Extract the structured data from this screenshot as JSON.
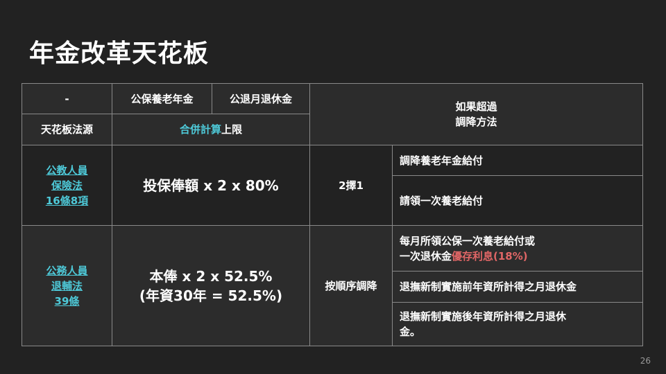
{
  "title": "年金改革天花板",
  "header": {
    "dash": "-",
    "col_insurance": "公保養老年金",
    "col_pension": "公退月退休金",
    "over_line1": "如果超過",
    "over_line2": "調降方法",
    "source_label": "天花板法源",
    "merge_teal": "合併計算",
    "merge_rest": "上限"
  },
  "rows": [
    {
      "law_line1": "公教人員",
      "law_line2": "保險法",
      "law_line3": "16條8項",
      "limit": "投保俸額 x 2 x 80%",
      "choice": "2擇1",
      "options": [
        "調降養老年金給付",
        "請領一次養老給付"
      ]
    },
    {
      "law_line1": "公務人員",
      "law_line2": "退輔法",
      "law_line3": "39條",
      "limit_line1": "本俸 x 2 x 52.5%",
      "limit_line2": "(年資30年 = 52.5%)",
      "choice": "按順序調降",
      "option1_line1": "每月所領公保一次養老給付或",
      "option1_line2_pre": "一次退休金",
      "option1_line2_red": "優存利息(18%)",
      "option2": "退撫新制實施前年資所計得之月退休金",
      "option3_line1": "退撫新制實施後年資所計得之月退休",
      "option3_line2": "金。"
    }
  ],
  "page_number": "26",
  "colors": {
    "background": "#222222",
    "border": "#8a8a8a",
    "link": "#4ec9d8",
    "highlight": "#e06666"
  }
}
